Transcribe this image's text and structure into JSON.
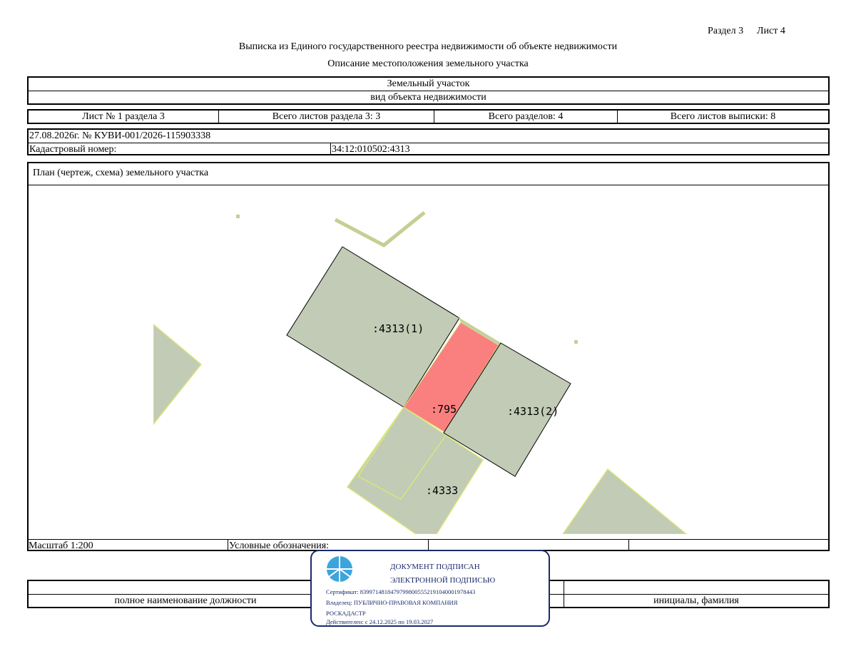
{
  "header": {
    "section": "Раздел 3",
    "sheet": "Лист 4",
    "title": "Выписка из Единого государственного реестра недвижимости об объекте недвижимости",
    "subtitle": "Описание местоположения земельного участка"
  },
  "object": {
    "type": "Земельный участок",
    "type_caption": "вид объекта недвижимости"
  },
  "sheets": {
    "sheet_no": "Лист № 1 раздела 3",
    "total_section_sheets": "Всего листов раздела 3: 3",
    "total_sections": "Всего разделов: 4",
    "total_extract_sheets": "Всего листов выписки: 8"
  },
  "record": {
    "date_number": "27.08.2026г. № КУВИ-001/2026-115903338",
    "cadastral_label": "Кадастровый номер:",
    "cadastral_value": "34:12:010502:4313"
  },
  "plan": {
    "title": "План (чертеж, схема) земельного участка",
    "labels": {
      "parcel_1": ":4313(1)",
      "parcel_795": ":795",
      "parcel_2": ":4313(2)",
      "parcel_4333": ":4333"
    }
  },
  "footer": {
    "scale": "Масштаб 1:200",
    "legend": "Условные обозначения:",
    "position_caption": "полное наименование должности",
    "name_caption": "инициалы, фамилия"
  },
  "stamp": {
    "line1": "ДОКУМЕНТ ПОДПИСАН",
    "line2": "ЭЛЕКТРОННОЙ ПОДПИСЬЮ",
    "certificate": "Сертификат: 839971481847979980055521910400019784​43",
    "owner": "Владелец: ПУБЛИЧНО-ПРАВОВАЯ КОМПАНИЯ",
    "owner_cont": "РОСКАДАСТР",
    "valid": "Действителен: с 24.12.2025 по 19.03.2027",
    "border_color": "#1a2a6c",
    "logo_color": "#3da5dc"
  },
  "colors": {
    "parcel_fill": "#c1cbb5",
    "parcel_highlight": "#fa8080",
    "boundary_yellow": "#dbe67a"
  }
}
